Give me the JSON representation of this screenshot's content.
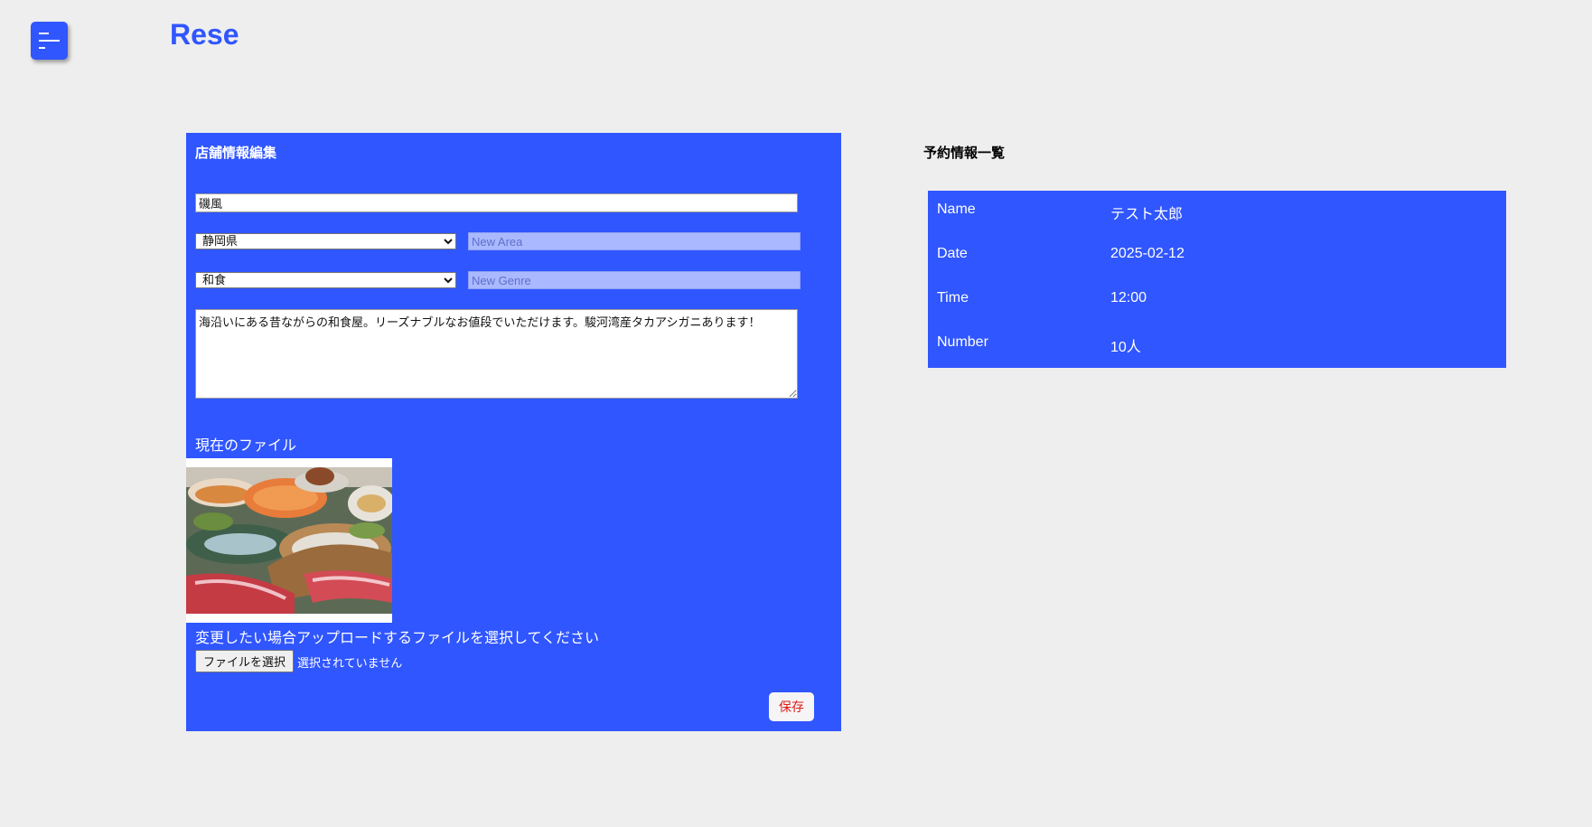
{
  "header": {
    "logo": "Rese",
    "menu_icon": "menu-icon"
  },
  "edit_panel": {
    "title": "店舗情報編集",
    "name_value": "磯風",
    "area_selected": "静岡県",
    "area_options": [
      "静岡県"
    ],
    "new_area_placeholder": "New Area",
    "genre_selected": "和食",
    "genre_options": [
      "和食"
    ],
    "new_genre_placeholder": "New Genre",
    "description": "海沿いにある昔ながらの和食屋。リーズナブルなお値段でいただけます。駿河湾産タカアシガニあります！",
    "current_file_label": "現在のファイル",
    "upload_hint": "変更したい場合アップロードするファイルを選択してください",
    "file_button_label": "ファイルを選択",
    "file_status": "選択されていません",
    "save_label": "保存"
  },
  "reservation": {
    "title": "予約情報一覧",
    "rows": [
      {
        "key": "Name",
        "value": "テスト太郎"
      },
      {
        "key": "Date",
        "value": "2025-02-12"
      },
      {
        "key": "Time",
        "value": "12:00"
      },
      {
        "key": "Number",
        "value": "10人"
      }
    ]
  },
  "colors": {
    "accent": "#3056ff",
    "background": "#eeeeee",
    "save_text": "#e01b1b"
  }
}
